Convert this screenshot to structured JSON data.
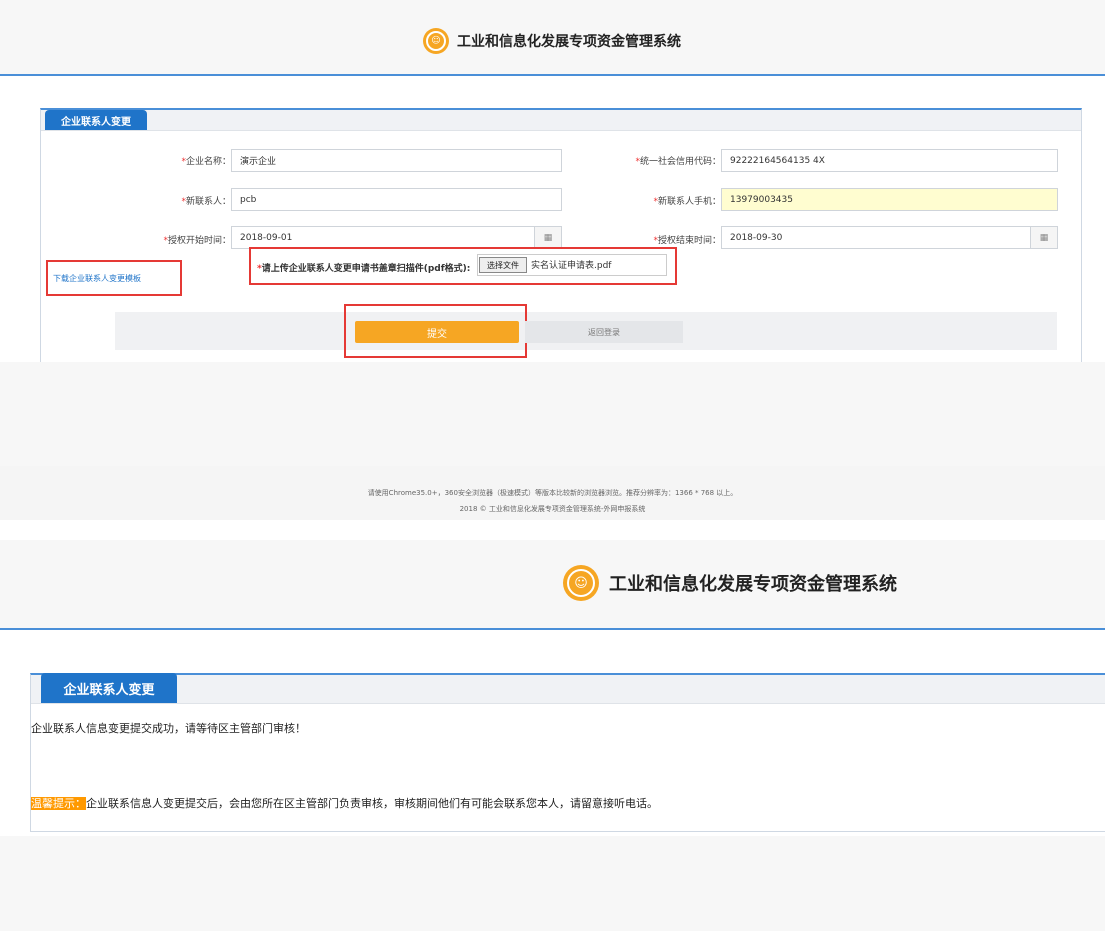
{
  "top": {
    "app_title": "工业和信息化发展专项资金管理系统",
    "tab_label": "企业联系人变更",
    "fields": {
      "company_name_label": "企业名称：",
      "company_name_value": "演示企业",
      "credit_code_label": "统一社会信用代码：",
      "credit_code_value": "92222164564135 4X",
      "new_contact_label": "新联系人：",
      "new_contact_value": "pcb",
      "new_phone_label": "新联系人手机：",
      "new_phone_value": "13979003435",
      "start_label": "授权开始时间：",
      "start_value": "2018-09-01",
      "end_label": "授权结束时间：",
      "end_value": "2018-09-30"
    },
    "download_link": "下载企业联系人变更模板",
    "upload_label": "请上传企业联系人变更申请书盖章扫描件(pdf格式):",
    "choose_file_button": "选择文件",
    "chosen_file": "实名认证申请表.pdf",
    "submit_button": "提交",
    "back_button": "返回登录",
    "footer_line1": "请使用Chrome35.0+，360安全浏览器（极速模式）等版本比较新的浏览器浏览。推荐分辨率为：1366 * 768 以上。",
    "footer_line2": "2018 © 工业和信息化发展专项资金管理系统-外网申报系统",
    "required_mark": "*",
    "calendar_icon": "calendar-icon"
  },
  "bottom": {
    "app_title": "工业和信息化发展专项资金管理系统",
    "tab_label": "企业联系人变更",
    "success_message": "企业联系人信息变更提交成功，请等待区主管部门审核！",
    "tip_label": "温馨提示：",
    "tip_text": "企业联系信息人变更提交后，会由您所在区主管部门负责审核，审核期间他们有可能会联系您本人，请留意接听电话。"
  },
  "colors": {
    "accent": "#1f74c9",
    "submit": "#f6a623",
    "highlight": "#ff9900",
    "redbox": "#e53935"
  }
}
